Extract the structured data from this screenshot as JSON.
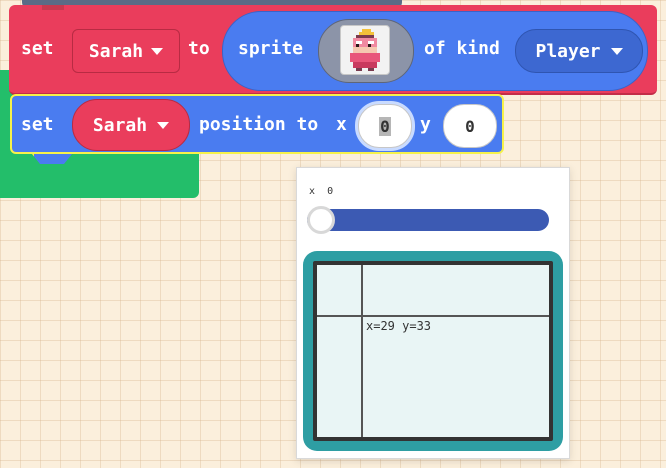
{
  "set_sprite_block": {
    "set_label": "set",
    "variable": "Sarah",
    "to_label": "to",
    "sprite_label": "sprite",
    "of_kind_label": "of kind",
    "kind": "Player"
  },
  "set_position_block": {
    "set_label": "set",
    "variable": "Sarah",
    "position_to_label": "position to",
    "x_label": "x",
    "x_value": "0",
    "y_label": "y",
    "y_value": "0"
  },
  "position_editor": {
    "slider_label": "x",
    "slider_value": "0",
    "slider_fraction": 0,
    "crosshair_readout": "x=29 y=33"
  },
  "colors": {
    "sprites_red": "#ea3d5c",
    "blocks_blue": "#4a7cf0",
    "loops_green": "#23be6a",
    "selection_yellow": "#f6f24a",
    "screen_teal": "#2e9ea3"
  },
  "icons": {
    "caret": "caret-down-icon",
    "sprite": "princess-sprite-icon"
  }
}
